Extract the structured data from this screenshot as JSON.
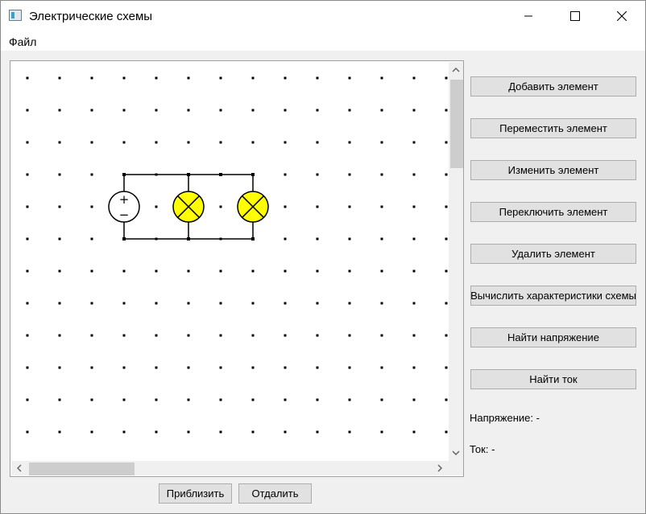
{
  "window": {
    "title": "Электрические схемы"
  },
  "menu": {
    "items": [
      "Файл"
    ]
  },
  "sidebar": {
    "buttons": [
      "Добавить элемент",
      "Переместить элемент",
      "Изменить элемент",
      "Переключить элемент",
      "Удалить элемент",
      "Вычислить характеристики схемы",
      "Найти напряжение",
      "Найти ток"
    ],
    "voltage_label": "Напряжение: -",
    "current_label": "Ток: -"
  },
  "footer": {
    "zoom_in": "Приблизить",
    "zoom_out": "Отдалить"
  },
  "circuit": {
    "grid_rows": 12,
    "grid_cols": 14,
    "elements": [
      {
        "kind": "voltage-source",
        "col": 3,
        "row": 4,
        "plus": "+",
        "minus": "−"
      },
      {
        "kind": "lamp",
        "col": 5,
        "row": 4,
        "color": "#ffff00"
      },
      {
        "kind": "lamp",
        "col": 7,
        "row": 4,
        "color": "#ffff00"
      }
    ]
  },
  "colors": {
    "lamp_fill": "#ffff00",
    "wire": "#000000",
    "grid_dot": "#000000"
  }
}
